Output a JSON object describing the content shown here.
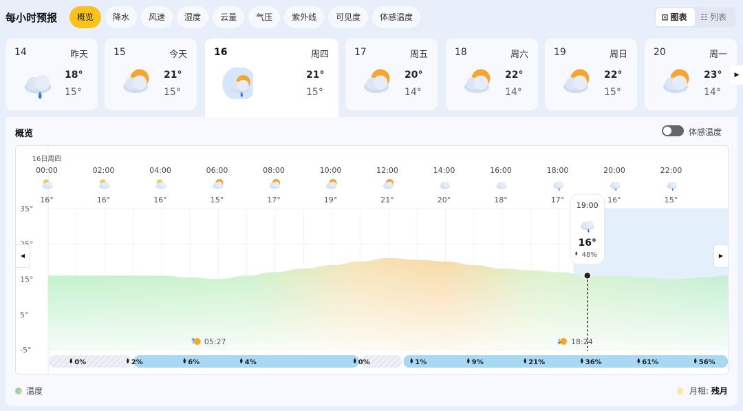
{
  "header": {
    "title": "每小时预报",
    "tabs": [
      "概览",
      "降水",
      "风速",
      "湿度",
      "云量",
      "气压",
      "紫外线",
      "可见度",
      "体感温度"
    ],
    "active_tab": "概览",
    "view_toggle": {
      "chart": "图表",
      "list": "列表",
      "active": "图表"
    }
  },
  "days": [
    {
      "num": "14",
      "weekday": "昨天",
      "high": "18°",
      "low": "15°",
      "icon": "rain-cloud-icon"
    },
    {
      "num": "15",
      "weekday": "今天",
      "high": "21°",
      "low": "15°",
      "icon": "partly-cloudy-icon"
    },
    {
      "num": "16",
      "weekday": "周四",
      "high": "21°",
      "low": "15°",
      "icon": "day-night-rain-icon",
      "selected": true
    },
    {
      "num": "17",
      "weekday": "周五",
      "high": "20°",
      "low": "14°",
      "icon": "partly-cloudy-icon"
    },
    {
      "num": "18",
      "weekday": "周六",
      "high": "22°",
      "low": "14°",
      "icon": "partly-cloudy-icon"
    },
    {
      "num": "19",
      "weekday": "周日",
      "high": "22°",
      "low": "15°",
      "icon": "partly-cloudy-icon"
    },
    {
      "num": "20",
      "weekday": "周一",
      "high": "23°",
      "low": "14°",
      "icon": "partly-cloudy-icon"
    }
  ],
  "overview": {
    "title": "概览",
    "feels_like_toggle": "体感温度",
    "legend_label": "温度",
    "moon_label": "月相:",
    "moon_phase": "残月"
  },
  "chart_data": {
    "type": "area",
    "date_label": "16日周四",
    "hours": [
      "00:00",
      "02:00",
      "04:00",
      "06:00",
      "08:00",
      "10:00",
      "12:00",
      "14:00",
      "16:00",
      "18:00",
      "20:00",
      "22:00"
    ],
    "hour_temps": [
      "16°",
      "16°",
      "16°",
      "15°",
      "17°",
      "19°",
      "21°",
      "20°",
      "18°",
      "17°",
      "16°",
      "15°"
    ],
    "hour_icons": [
      "night-cloudy-icon",
      "night-cloudy-icon",
      "night-cloudy-icon",
      "partly-cloudy-icon",
      "partly-cloudy-icon",
      "partly-cloudy-icon",
      "partly-cloudy-icon",
      "cloudy-icon",
      "cloudy-icon",
      "rain-icon",
      "rain-icon",
      "rain-icon"
    ],
    "y_ticks": [
      "35°",
      "25°",
      "15°",
      "5°",
      "-5°"
    ],
    "ylim": [
      -5,
      35
    ],
    "temperature": {
      "x": [
        0,
        1,
        2,
        3,
        4,
        5,
        6,
        7,
        8,
        9,
        10,
        11,
        12,
        13,
        14,
        15,
        16,
        17,
        18,
        19,
        20,
        21,
        22,
        23,
        24
      ],
      "y": [
        16,
        16,
        16,
        16,
        16,
        15.5,
        15,
        16,
        17,
        18,
        19,
        20,
        21,
        20.5,
        20,
        19,
        18,
        17.5,
        17,
        16,
        16,
        15.5,
        15,
        15.5,
        16
      ]
    },
    "sunrise": "05:27",
    "sunset": "18:24",
    "precipitation": [
      {
        "label": "0%",
        "hour": 1
      },
      {
        "label": "2%",
        "hour": 3
      },
      {
        "label": "6%",
        "hour": 5
      },
      {
        "label": "4%",
        "hour": 7
      },
      {
        "label": "0%",
        "hour": 11
      },
      {
        "label": "1%",
        "hour": 13
      },
      {
        "label": "9%",
        "hour": 15
      },
      {
        "label": "21%",
        "hour": 17
      },
      {
        "label": "36%",
        "hour": 19
      },
      {
        "label": "61%",
        "hour": 21
      },
      {
        "label": "56%",
        "hour": 23
      }
    ],
    "tooltip": {
      "time": "19:00",
      "temp": "16°",
      "precip": "48%",
      "icon": "rain-cloud-icon"
    }
  }
}
